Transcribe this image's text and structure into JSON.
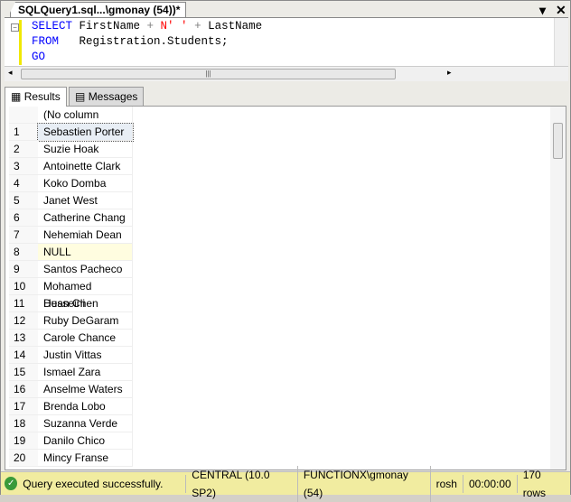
{
  "window": {
    "tab_title": "SQLQuery1.sql...\\gmonay (54))*"
  },
  "editor": {
    "line1": {
      "kw": "SELECT",
      "a": " FirstName ",
      "op1": "+",
      "str": " N' ' ",
      "op2": "+",
      "b": " LastName"
    },
    "line2": {
      "kw": "FROM",
      "a": "   Registration.Students;"
    },
    "line3": {
      "kw": "GO"
    }
  },
  "result_tabs": [
    {
      "label": "Results",
      "icon": "grid-icon",
      "active": true
    },
    {
      "label": "Messages",
      "icon": "messages-icon",
      "active": false
    }
  ],
  "grid": {
    "column_header": "(No column name)",
    "rows": [
      {
        "n": "1",
        "v": "Sebastien Porter"
      },
      {
        "n": "2",
        "v": "Suzie Hoak"
      },
      {
        "n": "3",
        "v": "Antoinette Clark"
      },
      {
        "n": "4",
        "v": "Koko Domba"
      },
      {
        "n": "5",
        "v": "Janet West"
      },
      {
        "n": "6",
        "v": "Catherine Chang"
      },
      {
        "n": "7",
        "v": "Nehemiah Dean"
      },
      {
        "n": "8",
        "v": "NULL"
      },
      {
        "n": "9",
        "v": "Santos Pacheco"
      },
      {
        "n": "10",
        "v": "Mohamed Husseini"
      },
      {
        "n": "11",
        "v": "Dean Chen"
      },
      {
        "n": "12",
        "v": "Ruby DeGaram"
      },
      {
        "n": "13",
        "v": "Carole Chance"
      },
      {
        "n": "14",
        "v": "Justin Vittas"
      },
      {
        "n": "15",
        "v": "Ismael Zara"
      },
      {
        "n": "16",
        "v": "Anselme Waters"
      },
      {
        "n": "17",
        "v": "Brenda Lobo"
      },
      {
        "n": "18",
        "v": "Suzanna Verde"
      },
      {
        "n": "19",
        "v": "Danilo Chico"
      },
      {
        "n": "20",
        "v": "Mincy Franse"
      }
    ]
  },
  "status": {
    "message": "Query executed successfully.",
    "server": "CENTRAL (10.0 SP2)",
    "user": "FUNCTIONX\\gmonay (54)",
    "database": "rosh",
    "time": "00:00:00",
    "rows": "170 rows",
    "color": "#f1eca0"
  }
}
